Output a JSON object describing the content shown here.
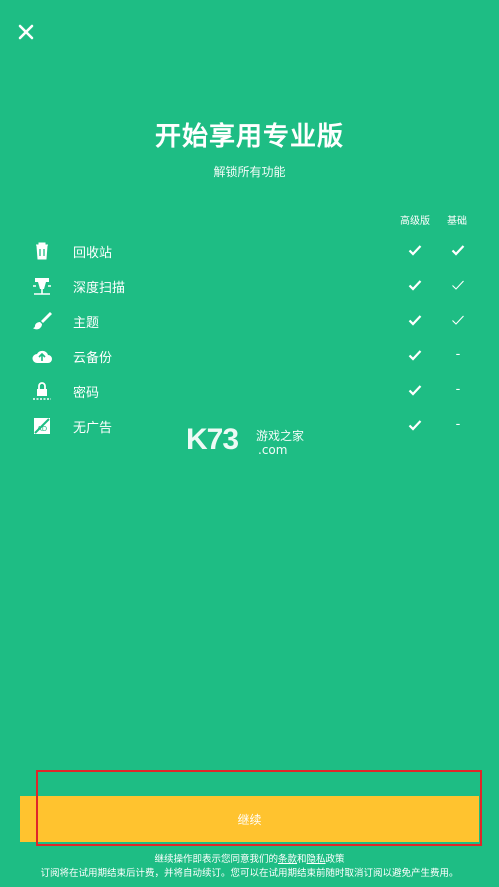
{
  "header": {
    "close_icon": "close-icon",
    "title": "开始享用专业版",
    "subtitle": "解锁所有功能"
  },
  "columns": {
    "premium": "高级版",
    "basic": "基础"
  },
  "features": [
    {
      "icon": "trash-icon",
      "label": "回收站",
      "premium": "check",
      "basic": "check"
    },
    {
      "icon": "scan-icon",
      "label": "深度扫描",
      "premium": "check",
      "basic": "check-outline"
    },
    {
      "icon": "brush-icon",
      "label": "主题",
      "premium": "check",
      "basic": "check-outline"
    },
    {
      "icon": "cloud-upload-icon",
      "label": "云备份",
      "premium": "check",
      "basic": "-"
    },
    {
      "icon": "lock-icon",
      "label": "密码",
      "premium": "check",
      "basic": "-"
    },
    {
      "icon": "no-ads-icon",
      "label": "无广告",
      "premium": "check",
      "basic": "-"
    }
  ],
  "watermark": {
    "logo": "K73",
    "name": "游戏之家",
    "domain": ".com"
  },
  "cta": {
    "continue_label": "继续"
  },
  "footer": {
    "terms_prefix": "继续操作即表示您同意我们的",
    "terms_link": "条款",
    "and": "和",
    "privacy_link": "隐私",
    "terms_suffix": "政策",
    "trial_note": "订阅将在试用期结束后计费，并将自动续订。您可以在试用期结束前随时取消订阅以避免产生费用。"
  },
  "colors": {
    "background": "#1ebd84",
    "button": "#ffc32f",
    "highlight": "#e0262a"
  }
}
